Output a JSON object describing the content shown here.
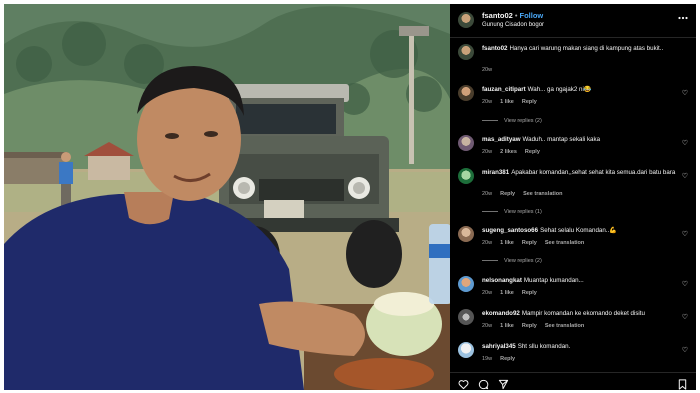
{
  "post": {
    "username": "fsanto02",
    "separator": "•",
    "follow_label": "Follow",
    "location": "Gunung Cisadon bogor",
    "more_icon": "more-horizontal-icon"
  },
  "caption": {
    "username": "fsanto02",
    "text": "Hanya cari warung makan siang di kampung atas bukit..",
    "time": "20w"
  },
  "comments": [
    {
      "username": "fauzan_citipart",
      "text": "Wah... ga ngajak2 ni",
      "emoji": "😂",
      "time": "20w",
      "likes": "1 like",
      "reply": "Reply",
      "view_replies": "View replies (2)"
    },
    {
      "username": "mas_adityaw",
      "text": "Waduh.. mantap sekali kaka",
      "time": "20w",
      "likes": "2 likes",
      "reply": "Reply"
    },
    {
      "username": "miran381",
      "text": "Apakabar komandan,,sehat sehat kita semua.dari batu bara",
      "time": "20w",
      "reply": "Reply",
      "translation": "See translation",
      "view_replies": "View replies (1)"
    },
    {
      "username": "sugeng_santoso66",
      "text": "Sehat selalu Komandan..",
      "emoji": "💪",
      "time": "20w",
      "likes": "1 like",
      "reply": "Reply",
      "translation": "See translation",
      "view_replies": "View replies (2)"
    },
    {
      "username": "nelsonangkat",
      "text": "Muantap kumandan...",
      "time": "20w",
      "likes": "1 like",
      "reply": "Reply"
    },
    {
      "username": "ekomando92",
      "text": "Mampir komandan ke ekomando deket disitu",
      "time": "20w",
      "likes": "1 like",
      "reply": "Reply",
      "translation": "See translation"
    },
    {
      "username": "sahriyal345",
      "text": "Sht sllu komandan.",
      "time": "19w",
      "reply": "Reply"
    }
  ],
  "actions": {
    "like_icon": "heart-icon",
    "comment_icon": "comment-icon",
    "share_icon": "send-icon",
    "save_icon": "bookmark-icon"
  },
  "colors": {
    "panel_bg": "#000000",
    "follow_blue": "#4aa7f5",
    "meta_gray": "#a8a8a8"
  }
}
